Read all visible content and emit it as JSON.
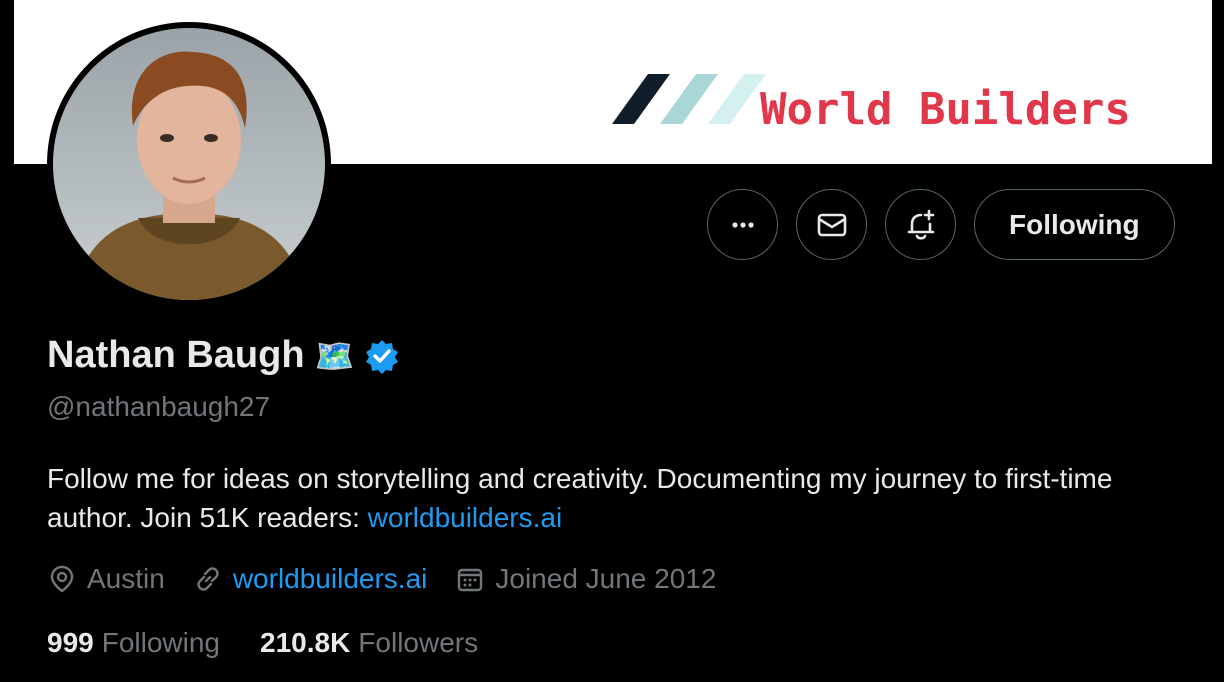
{
  "banner": {
    "title": "World Builders",
    "logo_colors": [
      "#0f1e2a",
      "#a9d6d6",
      "#d4f1ef"
    ]
  },
  "avatar": {
    "alt": "profile photo"
  },
  "actions": {
    "more_icon": "ellipsis-icon",
    "message_icon": "envelope-icon",
    "notify_icon": "bell-plus-icon",
    "follow_label": "Following"
  },
  "profile": {
    "name": "Nathan Baugh",
    "name_emoji": "🗺️",
    "verified_icon": "verified-badge-icon",
    "handle": "@nathanbaugh27",
    "bio_text": "Follow me for ideas on storytelling and creativity. Documenting my journey to first-time author. Join 51K readers: ",
    "bio_link": "worldbuilders.ai"
  },
  "meta": {
    "location": "Austin",
    "website": "worldbuilders.ai",
    "joined": "Joined June 2012"
  },
  "stats": {
    "following_count": "999",
    "following_label": "Following",
    "followers_count": "210.8K",
    "followers_label": "Followers"
  },
  "colors": {
    "accent": "#1d9bf0",
    "muted": "#71767b",
    "text": "#e7e9ea",
    "banner_text": "#e0384a"
  }
}
